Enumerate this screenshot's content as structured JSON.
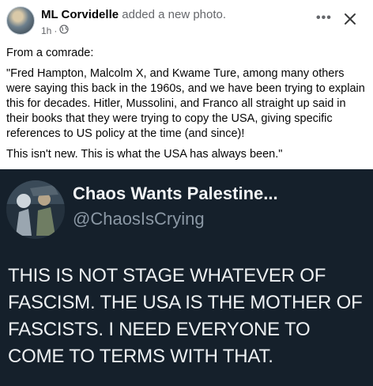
{
  "post": {
    "author": "ML Corvidelle",
    "action": "added a new photo.",
    "time": "1h",
    "dot": "·",
    "more_glyph": "•••",
    "paragraphs": [
      "From a comrade:",
      "\"Fred Hampton, Malcolm X, and Kwame Ture, among many others were saying this back in the 1960s, and we have been trying to explain this for decades. Hitler, Mussolini, and Franco all straight up said in their books that they were trying to copy the USA, giving specific references to US policy at the time (and since)!",
      "This isn't new. This is what the USA has always been.\""
    ]
  },
  "tweet": {
    "display_name": "Chaos Wants Palestine...",
    "handle": "@ChaosIsCrying",
    "text": "THIS IS NOT STAGE WHATEVER OF FASCISM. THE USA IS THE MOTHER OF FASCISTS. I NEED EVERYONE TO COME TO TERMS WITH THAT."
  },
  "colors": {
    "post_bg": "#ffffff",
    "tweet_bg": "#15202b",
    "secondary_text": "#65676b",
    "handle_text": "#8b98a5"
  },
  "icons": [
    "globe-icon",
    "more-options-icon",
    "close-icon"
  ]
}
